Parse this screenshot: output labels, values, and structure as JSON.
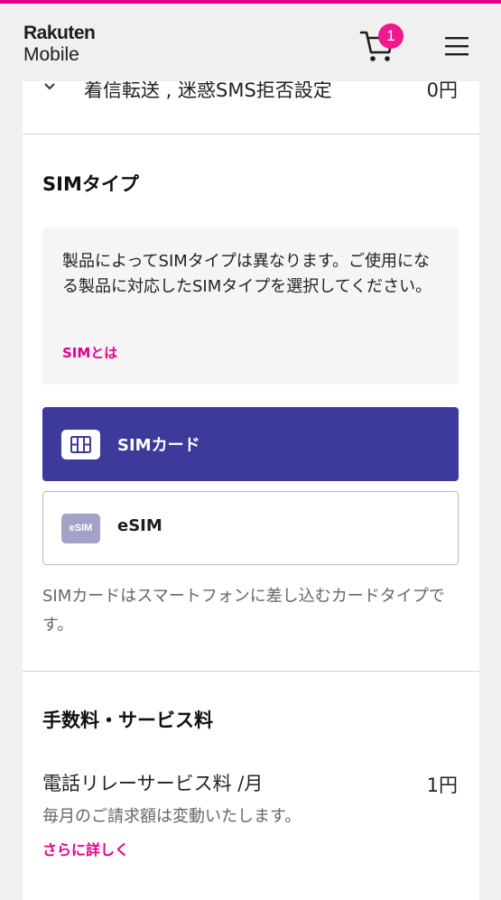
{
  "header": {
    "logo_line1": "Rakuten",
    "logo_line2": "Mobile",
    "cart_count": "1"
  },
  "prev_row": {
    "label": "着信転送 , 迷惑SMS拒否設定",
    "price": "0円"
  },
  "sim_section": {
    "title": "SIMタイプ",
    "info_text": "製品によってSIMタイプは異なります。ご使用になる製品に対応したSIMタイプを選択してください。",
    "info_link": "SIMとは",
    "options": [
      {
        "label": "SIMカード",
        "selected": true,
        "icon": "sim-card-icon"
      },
      {
        "label": "eSIM",
        "selected": false,
        "icon": "esim-icon",
        "icon_text": "eSIM"
      }
    ],
    "note": "SIMカードはスマートフォンに差し込むカードタイプです。"
  },
  "fee_section": {
    "title": "手数料・サービス料",
    "item_label": "電話リレーサービス料 /月",
    "item_price": "1円",
    "item_sub": "毎月のご請求額は変動いたします。",
    "item_link": "さらに詳しく"
  },
  "colors": {
    "accent": "#e8008a",
    "selected_bg": "#3d3a9c",
    "esim_icon_bg": "#a3a2c8"
  }
}
